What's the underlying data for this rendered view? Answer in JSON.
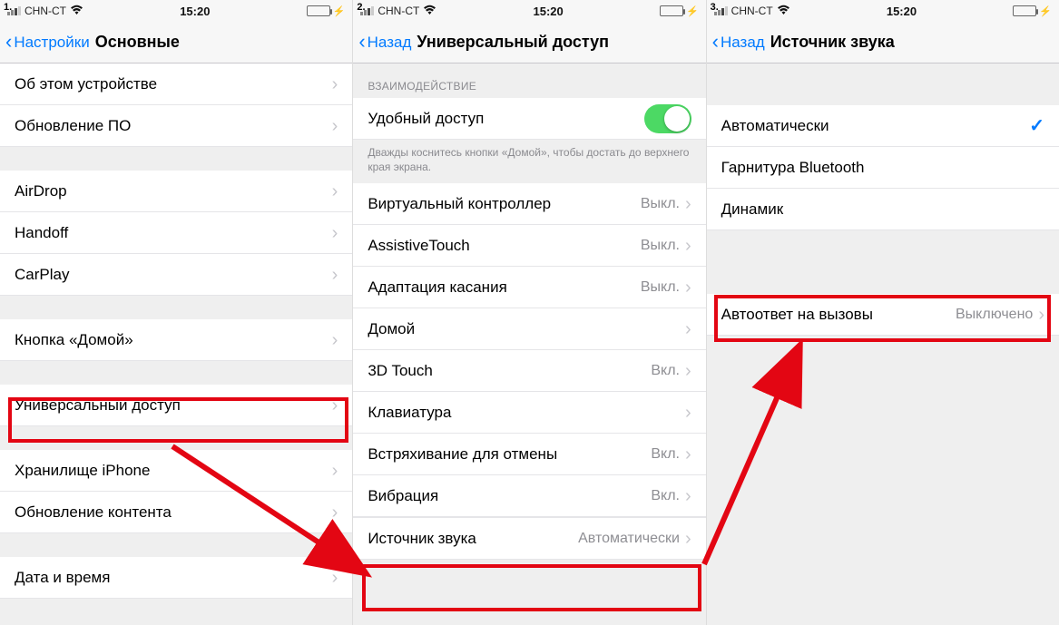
{
  "status": {
    "carrier": "CHN-CT",
    "time": "15:20"
  },
  "screen1": {
    "num": "1.",
    "back": "Настройки",
    "title": "Основные",
    "rows_a": [
      "Об этом устройстве",
      "Обновление ПО"
    ],
    "rows_b": [
      "AirDrop",
      "Handoff",
      "CarPlay"
    ],
    "rows_c": [
      "Кнопка «Домой»"
    ],
    "rows_d": [
      "Универсальный доступ"
    ],
    "rows_e": [
      "Хранилище iPhone",
      "Обновление контента"
    ],
    "rows_f": [
      "Дата и время"
    ]
  },
  "screen2": {
    "num": "2.",
    "back": "Назад",
    "title": "Универсальный доступ",
    "section_header": "ВЗАИМОДЕЙСТВИЕ",
    "toggle_label": "Удобный доступ",
    "footer": "Дважды коснитесь кнопки «Домой», чтобы достать до верхнего края экрана.",
    "rows": [
      {
        "label": "Виртуальный контроллер",
        "value": "Выкл."
      },
      {
        "label": "AssistiveTouch",
        "value": "Выкл."
      },
      {
        "label": "Адаптация касания",
        "value": "Выкл."
      },
      {
        "label": "Домой",
        "value": ""
      },
      {
        "label": "3D Touch",
        "value": "Вкл."
      },
      {
        "label": "Клавиатура",
        "value": ""
      },
      {
        "label": "Встряхивание для отмены",
        "value": "Вкл."
      },
      {
        "label": "Вибрация",
        "value": "Вкл."
      }
    ],
    "last_row": {
      "label": "Источник звука",
      "value": "Автоматически"
    }
  },
  "screen3": {
    "num": "3.",
    "back": "Назад",
    "title": "Источник звука",
    "options": [
      {
        "label": "Автоматически",
        "checked": true
      },
      {
        "label": "Гарнитура Bluetooth",
        "checked": false
      },
      {
        "label": "Динамик",
        "checked": false
      }
    ],
    "auto_answer": {
      "label": "Автоответ на вызовы",
      "value": "Выключено"
    }
  }
}
